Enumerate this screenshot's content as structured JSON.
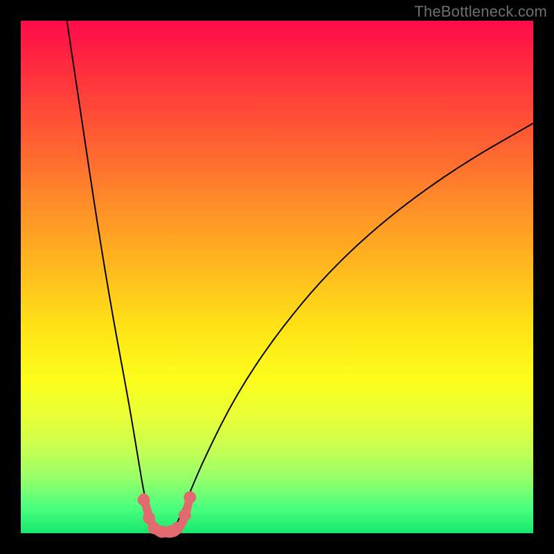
{
  "watermark": "TheBottleneck.com",
  "chart_data": {
    "type": "line",
    "title": "",
    "xlabel": "",
    "ylabel": "",
    "xlim": [
      0,
      100
    ],
    "ylim": [
      0,
      100
    ],
    "grid": false,
    "legend": false,
    "background_gradient": {
      "direction": "vertical",
      "stops": [
        {
          "pos": 0,
          "color": "#ff0b49"
        },
        {
          "pos": 50,
          "color": "#ffc81e"
        },
        {
          "pos": 72,
          "color": "#fdfe1c"
        },
        {
          "pos": 100,
          "color": "#17e86f"
        }
      ]
    },
    "series": [
      {
        "name": "left-branch",
        "color": "#000000",
        "x": [
          9,
          12,
          15,
          18,
          21,
          23,
          24,
          25,
          26,
          27
        ],
        "y": [
          100,
          80,
          60,
          42,
          26,
          14,
          8,
          4,
          1,
          0
        ]
      },
      {
        "name": "right-branch",
        "color": "#000000",
        "x": [
          29,
          30,
          31,
          33,
          36,
          42,
          50,
          60,
          72,
          86,
          100
        ],
        "y": [
          0,
          1,
          3,
          8,
          15,
          27,
          39,
          51,
          62,
          72,
          80
        ]
      },
      {
        "name": "trough-band",
        "color": "#e16a6f",
        "x": [
          24,
          25,
          26,
          27,
          28,
          29,
          30,
          31,
          32,
          33
        ],
        "y": [
          7,
          3,
          1,
          0,
          0,
          0,
          0,
          1,
          3,
          7
        ]
      }
    ],
    "markers": [
      {
        "x": 24.0,
        "y": 6.5,
        "r": 1.2,
        "color": "#e16a6f"
      },
      {
        "x": 25.0,
        "y": 3.0,
        "r": 1.2,
        "color": "#e16a6f"
      },
      {
        "x": 26.0,
        "y": 1.0,
        "r": 1.2,
        "color": "#e16a6f"
      },
      {
        "x": 27.5,
        "y": 0.3,
        "r": 1.2,
        "color": "#e16a6f"
      },
      {
        "x": 29.0,
        "y": 0.3,
        "r": 1.2,
        "color": "#e16a6f"
      },
      {
        "x": 30.5,
        "y": 1.0,
        "r": 1.2,
        "color": "#e16a6f"
      },
      {
        "x": 32.0,
        "y": 3.5,
        "r": 1.2,
        "color": "#e16a6f"
      },
      {
        "x": 33.0,
        "y": 7.0,
        "r": 1.2,
        "color": "#e16a6f"
      }
    ]
  }
}
